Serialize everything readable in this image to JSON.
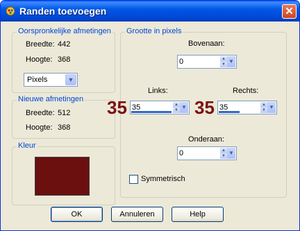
{
  "window": {
    "title": "Randen toevoegen",
    "close_glyph": "✕"
  },
  "original_dimensions": {
    "legend": "Oorspronkelijke afmetingen",
    "width_label": "Breedte:",
    "width_value": "442",
    "height_label": "Hoogte:",
    "height_value": "368",
    "unit_select": "Pixels"
  },
  "new_dimensions": {
    "legend": "Nieuwe afmetingen",
    "width_label": "Breedte:",
    "width_value": "512",
    "height_label": "Hoogte:",
    "height_value": "368"
  },
  "color": {
    "legend": "Kleur",
    "value": "#6b0f0f"
  },
  "size_pixels": {
    "legend": "Grootte in pixels",
    "top_label": "Bovenaan:",
    "top_value": "0",
    "left_label": "Links:",
    "left_value": "35",
    "right_label": "Rechts:",
    "right_value": "35",
    "bottom_label": "Onderaan:",
    "bottom_value": "0",
    "symmetric_label": "Symmetrisch",
    "symmetric_checked": false
  },
  "annotations": {
    "left_big": "35",
    "right_big": "35"
  },
  "buttons": {
    "ok": "OK",
    "cancel": "Annuleren",
    "help": "Help"
  }
}
